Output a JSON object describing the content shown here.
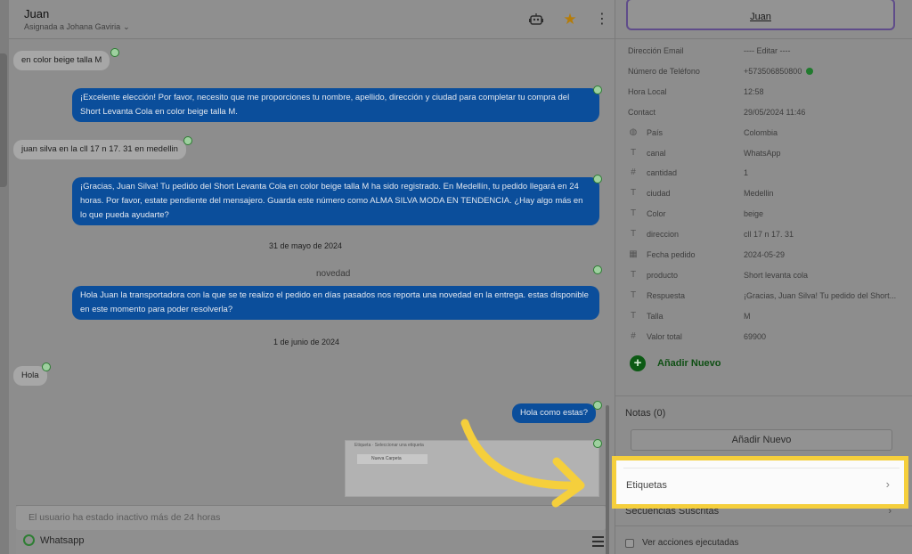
{
  "header": {
    "contact_name": "Juan",
    "assigned": "Asignada a Johana Gaviria",
    "icons": [
      "robot-icon",
      "star-icon",
      "more-vertical-icon"
    ]
  },
  "messages": [
    {
      "dir": "in",
      "text": "en color beige talla M"
    },
    {
      "dir": "out",
      "text": "¡Excelente elección! Por favor, necesito que me proporciones tu nombre, apellido, dirección y ciudad para completar tu compra del Short Levanta Cola en color beige talla M."
    },
    {
      "dir": "in",
      "text": "juan silva en la cll 17 n 17. 31 en medellin"
    },
    {
      "dir": "out",
      "text": "¡Gracias, Juan Silva! Tu pedido del Short Levanta Cola en color beige talla M ha sido registrado. En Medellín, tu pedido llegará en 24 horas. Por favor, estate pendiente del mensajero. Guarda este número como ALMA SILVA MODA EN TENDENCIA. ¿Hay algo más en lo que pueda ayudarte?"
    },
    {
      "dir": "date",
      "text": "31 de mayo de 2024"
    },
    {
      "dir": "note",
      "text": "novedad"
    },
    {
      "dir": "out",
      "text": "Hola Juan la transportadora con la que se te realizo el pedido en días pasados nos reporta una novedad en la entrega. estas disponible en este momento para poder resolverla?"
    },
    {
      "dir": "date",
      "text": "1 de junio de 2024"
    },
    {
      "dir": "in",
      "text": "Hola"
    },
    {
      "dir": "out",
      "text": "Hola como estas?"
    }
  ],
  "attachment": {
    "line": "Etiqueta  ·  Seleccionar una etiqueta",
    "chip": "Nueva Carpeta"
  },
  "composer": {
    "placeholder": "El usuario ha estado inactivo más de 24 horas",
    "channel": "Whatsapp"
  },
  "sidebar": {
    "contact_name": "Juan",
    "fields": [
      {
        "label": "Dirección Email",
        "value": "---- Editar ----",
        "icon": ""
      },
      {
        "label": "Número de Teléfono",
        "value": "+573506850800",
        "icon": "",
        "verified": true
      },
      {
        "label": "Hora Local",
        "value": "12:58",
        "icon": ""
      },
      {
        "label": "Contact",
        "value": "29/05/2024 11:46",
        "icon": ""
      },
      {
        "label": "País",
        "value": "Colombia",
        "icon": "globe-icon"
      },
      {
        "label": "canal",
        "value": "WhatsApp",
        "icon": "text-icon"
      },
      {
        "label": "cantidad",
        "value": "1",
        "icon": "hash-icon"
      },
      {
        "label": "ciudad",
        "value": "Medellin",
        "icon": "text-icon"
      },
      {
        "label": "Color",
        "value": "beige",
        "icon": "text-icon"
      },
      {
        "label": "direccion",
        "value": "cll 17 n 17. 31",
        "icon": "text-icon"
      },
      {
        "label": "Fecha pedido",
        "value": "2024-05-29",
        "icon": "calendar-icon"
      },
      {
        "label": "producto",
        "value": "Short levanta cola",
        "icon": "text-icon"
      },
      {
        "label": "Respuesta",
        "value": "¡Gracias, Juan Silva! Tu pedido del Short...",
        "icon": "text-icon"
      },
      {
        "label": "Talla",
        "value": "M",
        "icon": "text-icon"
      },
      {
        "label": "Valor total",
        "value": "69900",
        "icon": "hash-icon"
      }
    ],
    "add_new": "Añadir Nuevo",
    "notes_label": "Notas (0)",
    "notes_button": "Añadir Nuevo",
    "etiquetas": "Etiquetas",
    "secuencias": "Secuencias Suscritas",
    "ver_acciones": "Ver acciones ejecutadas"
  },
  "colors": {
    "outgoing_bubble": "#0b4e9b",
    "highlight": "#f5cf3c",
    "accent_green": "#0c5a14"
  }
}
